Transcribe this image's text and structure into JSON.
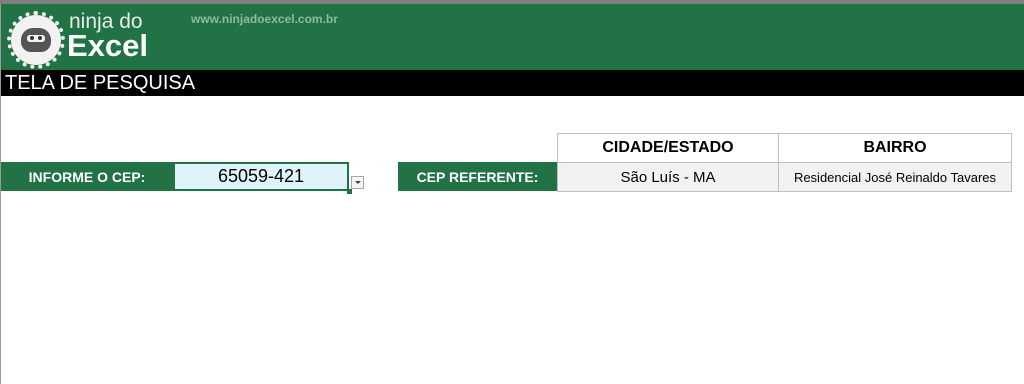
{
  "logo": {
    "line1": "ninja do",
    "line2": "Excel",
    "site_url": "www.ninjadoexcel.com.br"
  },
  "title_bar": {
    "text": "TELA DE PESQUISA"
  },
  "search": {
    "label": "INFORME O CEP:",
    "value": "65059-421"
  },
  "result": {
    "label": "CEP REFERENTE:",
    "headers": [
      "CIDADE/ESTADO",
      "BAIRRO"
    ],
    "values": [
      "São Luís - MA",
      "Residencial José Reinaldo Tavares"
    ]
  },
  "colors": {
    "brand_green": "#217346",
    "title_bar": "#000000",
    "input_fill": "#dff3fb",
    "cell_fill": "#f2f2f2"
  }
}
